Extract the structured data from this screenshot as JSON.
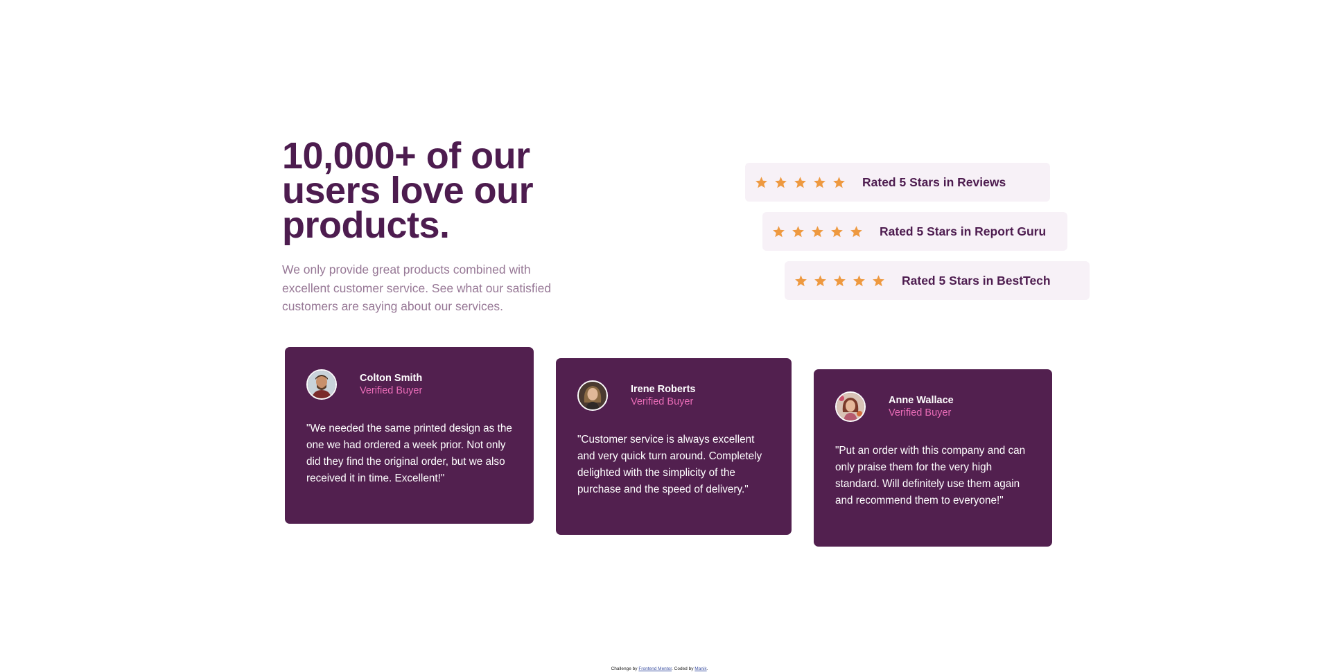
{
  "hero": {
    "title": "10,000+ of our users love our products.",
    "description": "We only provide great products combined with excellent customer service. See what our satisfied customers are saying about our services."
  },
  "ratings": [
    {
      "label": "Rated 5 Stars in Reviews",
      "stars": 5
    },
    {
      "label": "Rated 5 Stars in Report Guru",
      "stars": 5
    },
    {
      "label": "Rated 5 Stars in BestTech",
      "stars": 5
    }
  ],
  "testimonials": [
    {
      "name": "Colton Smith",
      "role": "Verified Buyer",
      "quote": "\"We needed the same printed design as the one we had ordered a week prior. Not only did they find the original order, but we also received it in time. Excellent!\""
    },
    {
      "name": "Irene Roberts",
      "role": "Verified Buyer",
      "quote": "\"Customer service is always excellent and very quick turn around. Completely delighted with the simplicity of the purchase and the speed of delivery.\""
    },
    {
      "name": "Anne Wallace",
      "role": "Verified Buyer",
      "quote": "\"Put an order with this company and can only praise them for the very high standard. Will definitely use them again and recommend them to everyone!\""
    }
  ],
  "footer": {
    "prefix": "Challenge by",
    "link1": "Frontend Mentor",
    "middle": ". Coded by",
    "link2": "Manik",
    "suffix": "."
  },
  "colors": {
    "primary": "#4d1c4f",
    "card_bg": "#52204f",
    "accent_pink": "#e96cb7",
    "star": "#ee9940",
    "rating_bg": "#f7f1f7",
    "muted_text": "#977896"
  },
  "icons": {
    "star": "star-icon"
  }
}
